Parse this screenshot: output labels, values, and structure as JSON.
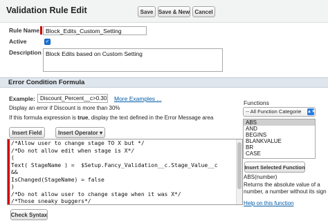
{
  "header": {
    "title": "Validation Rule Edit",
    "buttons": {
      "save": "Save",
      "save_new": "Save & New",
      "cancel": "Cancel"
    }
  },
  "form": {
    "rule_name_label": "Rule Name",
    "rule_name_value": "Block_Edits_Custom_Setting",
    "active_label": "Active",
    "active_checked": true,
    "description_label": "Description",
    "description_value": "Block Edits based on Custom Setting"
  },
  "section": {
    "title": "Error Condition Formula",
    "example_label": "Example:",
    "example_value": "Discount_Percent__c>0.30",
    "more_examples": "More Examples ...",
    "example_desc": "Display an error if Discount is more than 30%",
    "hint_prefix": "If this formula expression is ",
    "hint_bold": "true",
    "hint_suffix": ", display the text defined in the Error Message area",
    "insert_field": "Insert Field",
    "insert_operator": "Insert Operator",
    "insert_operator_arrow": "▾",
    "check_syntax": "Check Syntax"
  },
  "editor": {
    "lines": [
      "/*Allow user to change stage TO X but */",
      "/*Do not allow edit when stage is X*/",
      "(",
      "Text( StageName ) =  $Setup.Fancy_Validation__c.Stage_Value__c",
      "&&",
      "IsChanged(StageName) = false",
      ")",
      "/*Do not allow user to change stage when it was X*/",
      "/*Those sneaky buggers*/",
      "||"
    ]
  },
  "functions": {
    "label": "Functions",
    "category": "-- All Function Categorie",
    "list": [
      "ABS",
      "AND",
      "BEGINS",
      "BLANKVALUE",
      "BR",
      "CASE"
    ],
    "selected": "ABS",
    "insert_button": "Insert Selected Function",
    "signature": "ABS(number)",
    "description": "Returns the absolute value of a number, a number without its sign",
    "help_link": "Help on this function"
  },
  "colors": {
    "required": "#cc0000",
    "link": "#015ba7",
    "section_band": "#dfe6ee",
    "checkbox": "#1a73d9"
  }
}
